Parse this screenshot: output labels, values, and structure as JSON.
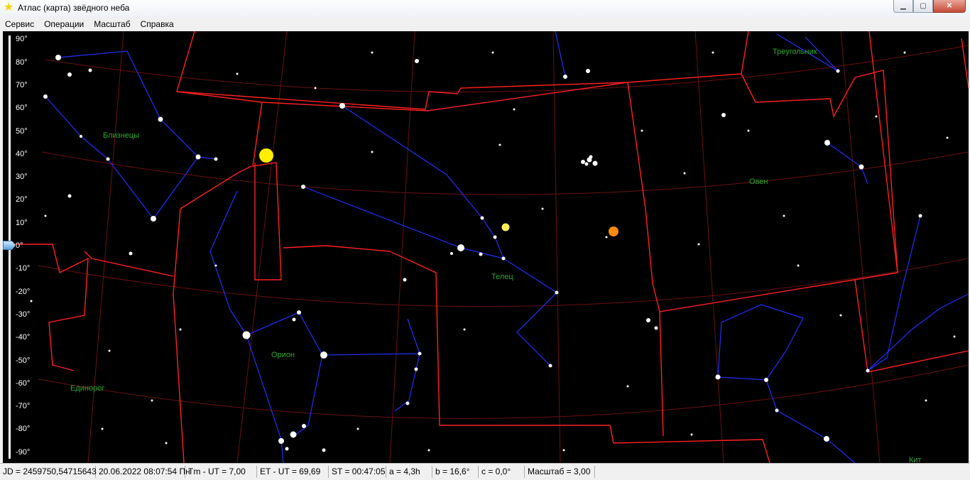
{
  "window": {
    "title": "Атлас (карта) звёдного неба",
    "icon": "star-icon"
  },
  "menu": [
    "Сервис",
    "Операции",
    "Масштаб",
    "Справка"
  ],
  "scale_labels": [
    "90°",
    "80°",
    "70°",
    "60°",
    "50°",
    "40°",
    "30°",
    "20°",
    "10°",
    "0°",
    "-10°",
    "-20°",
    "-30°",
    "-40°",
    "-50°",
    "-60°",
    "-70°",
    "-80°",
    "-90°"
  ],
  "constellations": [
    "Близнецы",
    "Треугольник",
    "Овен",
    "Телец",
    "Орион",
    "Единорог",
    "Кит"
  ],
  "status": [
    "JD = 2459750,54715643",
    "20.06.2022 08:07:54 Пн",
    "Tm - UT = 7,00",
    "ET - UT = 69,69",
    "ST = 00:47:05",
    "a = 4,3h",
    "b = 16,6°",
    "c = 0,0°",
    "Масштаб = 3,00"
  ],
  "colors": {
    "sky": "#000000",
    "boundary": "#ff2020",
    "lines": "#2030ff",
    "labels": "#2ea82e",
    "grid": "#6a1010",
    "sun": "#ffee00",
    "planet_orange": "#ff8a10"
  }
}
